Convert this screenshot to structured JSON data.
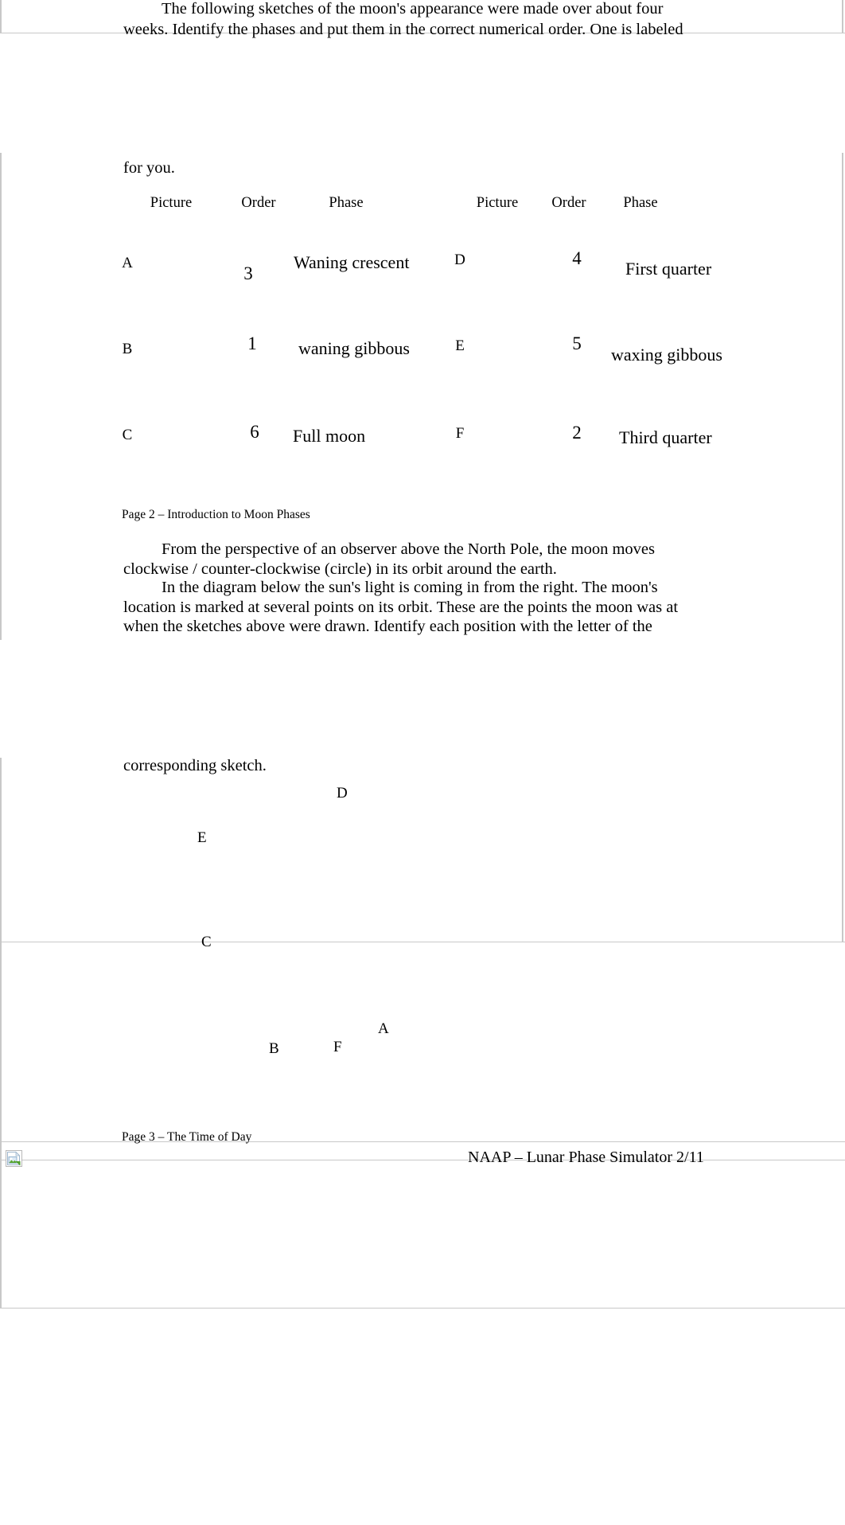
{
  "document": {
    "type": "worksheet",
    "subject": "Moon Phases"
  },
  "intro_paragraph": {
    "line1": "The following sketches of the moon's appearance were made over about four",
    "line2": "weeks. Identify the phases and put them in the correct numerical order. One is labeled",
    "line3": "for you."
  },
  "table": {
    "headers_left": {
      "picture": "Picture",
      "order": "Order",
      "phase": "Phase"
    },
    "headers_right": {
      "picture": "Picture",
      "order": "Order",
      "phase": "Phase"
    },
    "rows_left": [
      {
        "picture": "A",
        "order": "3",
        "phase": "Waning crescent"
      },
      {
        "picture": "B",
        "order": "1",
        "phase": "waning gibbous"
      },
      {
        "picture": "C",
        "order": "6",
        "phase": "Full moon"
      }
    ],
    "rows_right": [
      {
        "picture": "D",
        "order": "4",
        "phase": "First quarter"
      },
      {
        "picture": "E",
        "order": "5",
        "phase": "waxing gibbous"
      },
      {
        "picture": "F",
        "order": "2",
        "phase": "Third quarter"
      }
    ]
  },
  "page2": {
    "footer": "Page 2 – Introduction to Moon Phases",
    "paragraph1": {
      "line1": "From the perspective of an observer above the North Pole, the moon moves",
      "line2": "clockwise / counter-clockwise (circle) in its orbit around the earth."
    },
    "paragraph2": {
      "line1": "In the diagram below the sun's light is coming in from the right. The moon's",
      "line2": "location is marked at several points on its orbit. These are the points the moon was at",
      "line3": "when the sketches above were drawn. Identify each position with the letter of the",
      "line4": "corresponding sketch."
    }
  },
  "orbit_diagram": {
    "labels": [
      {
        "text": "D"
      },
      {
        "text": "E"
      },
      {
        "text": "C"
      },
      {
        "text": "A"
      },
      {
        "text": "B"
      },
      {
        "text": "F"
      }
    ]
  },
  "page3": {
    "footer": "Page 3 – The Time of Day"
  },
  "naap_footer": {
    "text": "NAAP – Lunar Phase Simulator 2/11",
    "image_placeholder_icon": "broken-image-icon"
  },
  "colors": {
    "text": "#000000",
    "rule": "#c8c8c8",
    "page_background": "#ffffff"
  }
}
